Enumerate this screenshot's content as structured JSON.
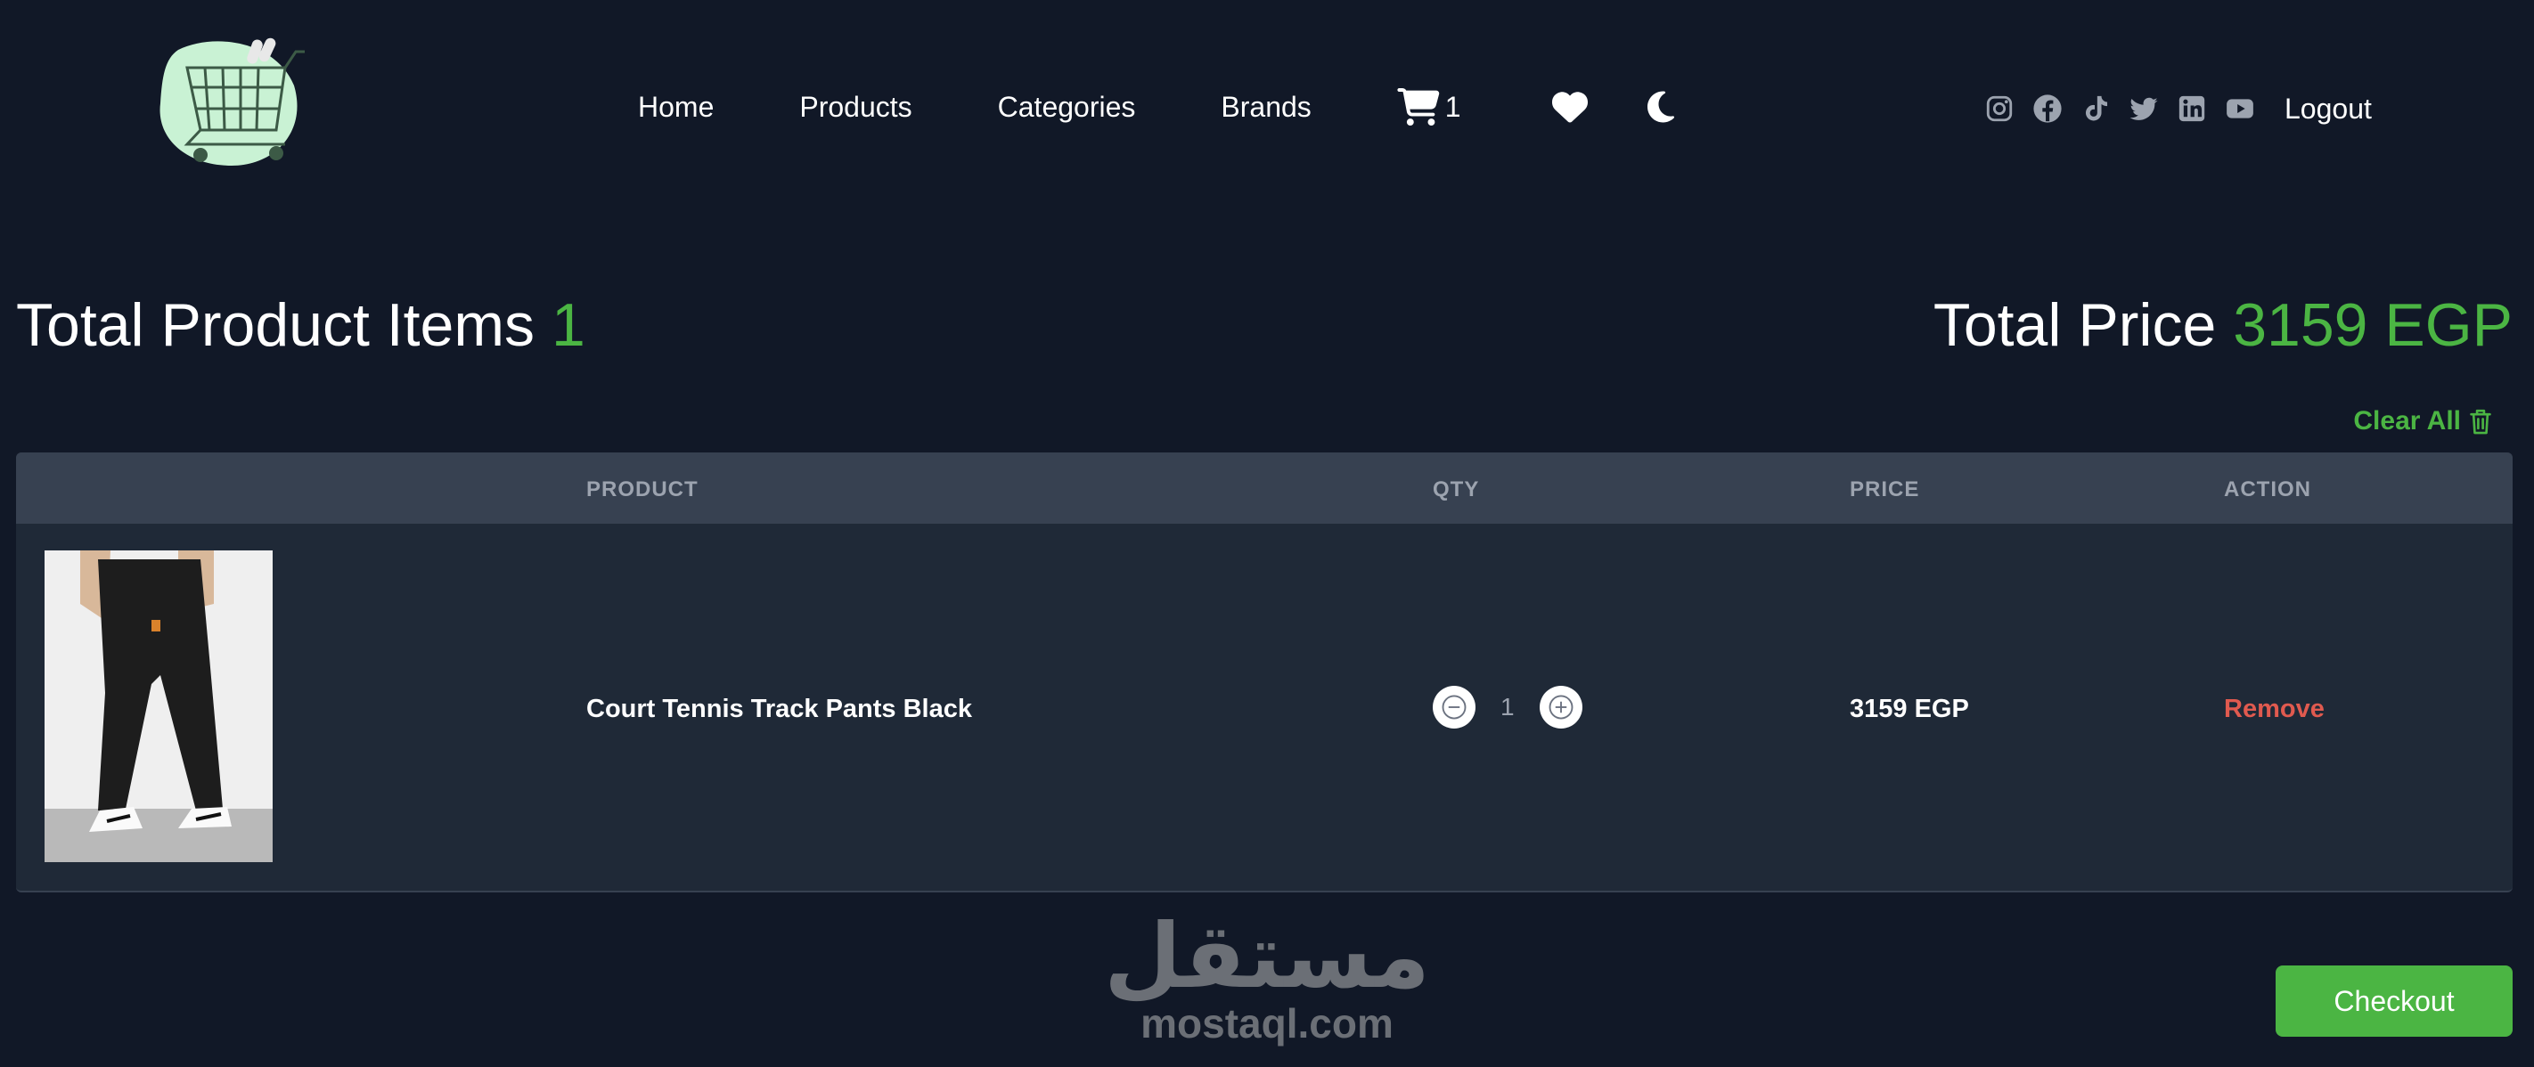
{
  "nav": {
    "links": [
      "Home",
      "Products",
      "Categories",
      "Brands"
    ],
    "cart_count": "1",
    "logout_label": "Logout",
    "icons": [
      "cart-icon",
      "heart-icon",
      "moon-icon"
    ],
    "social_icons": [
      "instagram-icon",
      "facebook-icon",
      "tiktok-icon",
      "twitter-icon",
      "linkedin-icon",
      "youtube-icon"
    ]
  },
  "summary": {
    "items_label": "Total Product Items",
    "items_count": "1",
    "price_label": "Total Price",
    "price_value": "3159 EGP"
  },
  "clear_all_label": "Clear All",
  "table": {
    "headers": [
      "PRODUCT",
      "QTY",
      "PRICE",
      "ACTION"
    ],
    "rows": [
      {
        "product": "Court Tennis Track Pants Black",
        "qty": "1",
        "price": "3159 EGP",
        "action": "Remove"
      }
    ]
  },
  "watermark": {
    "arabic": "مستقل",
    "latin": "mostaql.com"
  },
  "checkout_label": "Checkout",
  "colors": {
    "background": "#111827",
    "accent": "#4bb543",
    "remove": "#e05a4f",
    "table_header": "#374151",
    "table_body": "#1f2937"
  }
}
